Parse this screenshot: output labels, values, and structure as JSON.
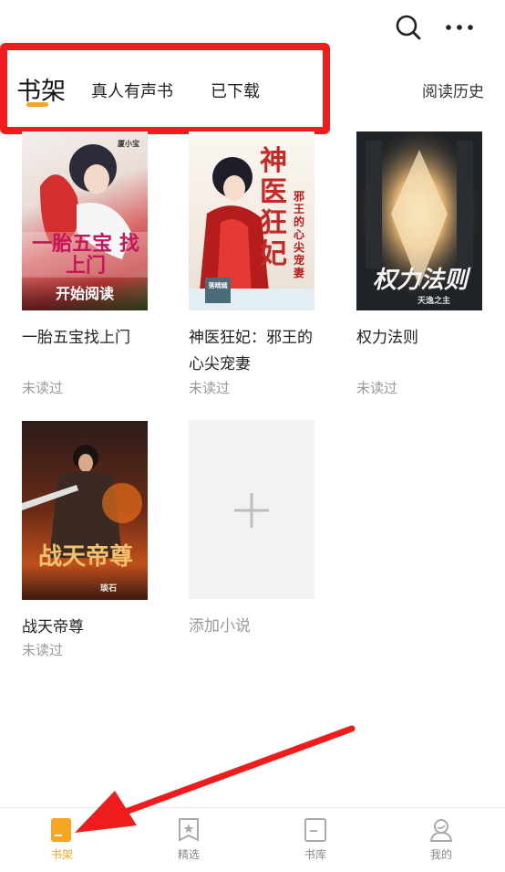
{
  "top_icons": {
    "search": "search-icon",
    "more": "more-icon"
  },
  "tabs": [
    {
      "label": "书架"
    },
    {
      "label": "真人有声书"
    },
    {
      "label": "已下载"
    }
  ],
  "history_label": "阅读历史",
  "books": [
    {
      "title": "一胎五宝找上门",
      "status": "未读过",
      "cover_overlay": "开始阅读",
      "cover_title": "一胎五宝 找上门",
      "cover_author": "厦小宝"
    },
    {
      "title": "神医狂妃：邪王的心尖宠妻",
      "status": "未读过",
      "cover_title": "神医狂妃",
      "cover_subtitle": "邪王的心尖宠妻",
      "cover_author": "落晴嫣"
    },
    {
      "title": "权力法则",
      "status": "未读过",
      "cover_title": "权力法则",
      "cover_author": "天逸之主"
    },
    {
      "title": "战天帝尊",
      "status": "未读过",
      "cover_title": "战天帝尊",
      "cover_author": "琰石"
    }
  ],
  "add_book_label": "添加小说",
  "bottom_nav": [
    {
      "label": "书架",
      "icon": "bookshelf-icon",
      "active": true
    },
    {
      "label": "精选",
      "icon": "featured-icon",
      "active": false
    },
    {
      "label": "书库",
      "icon": "library-icon",
      "active": false
    },
    {
      "label": "我的",
      "icon": "profile-icon",
      "active": false
    }
  ],
  "colors": {
    "accent": "#f5a623",
    "annotation_red": "#ee1c1c",
    "muted": "#999999"
  }
}
